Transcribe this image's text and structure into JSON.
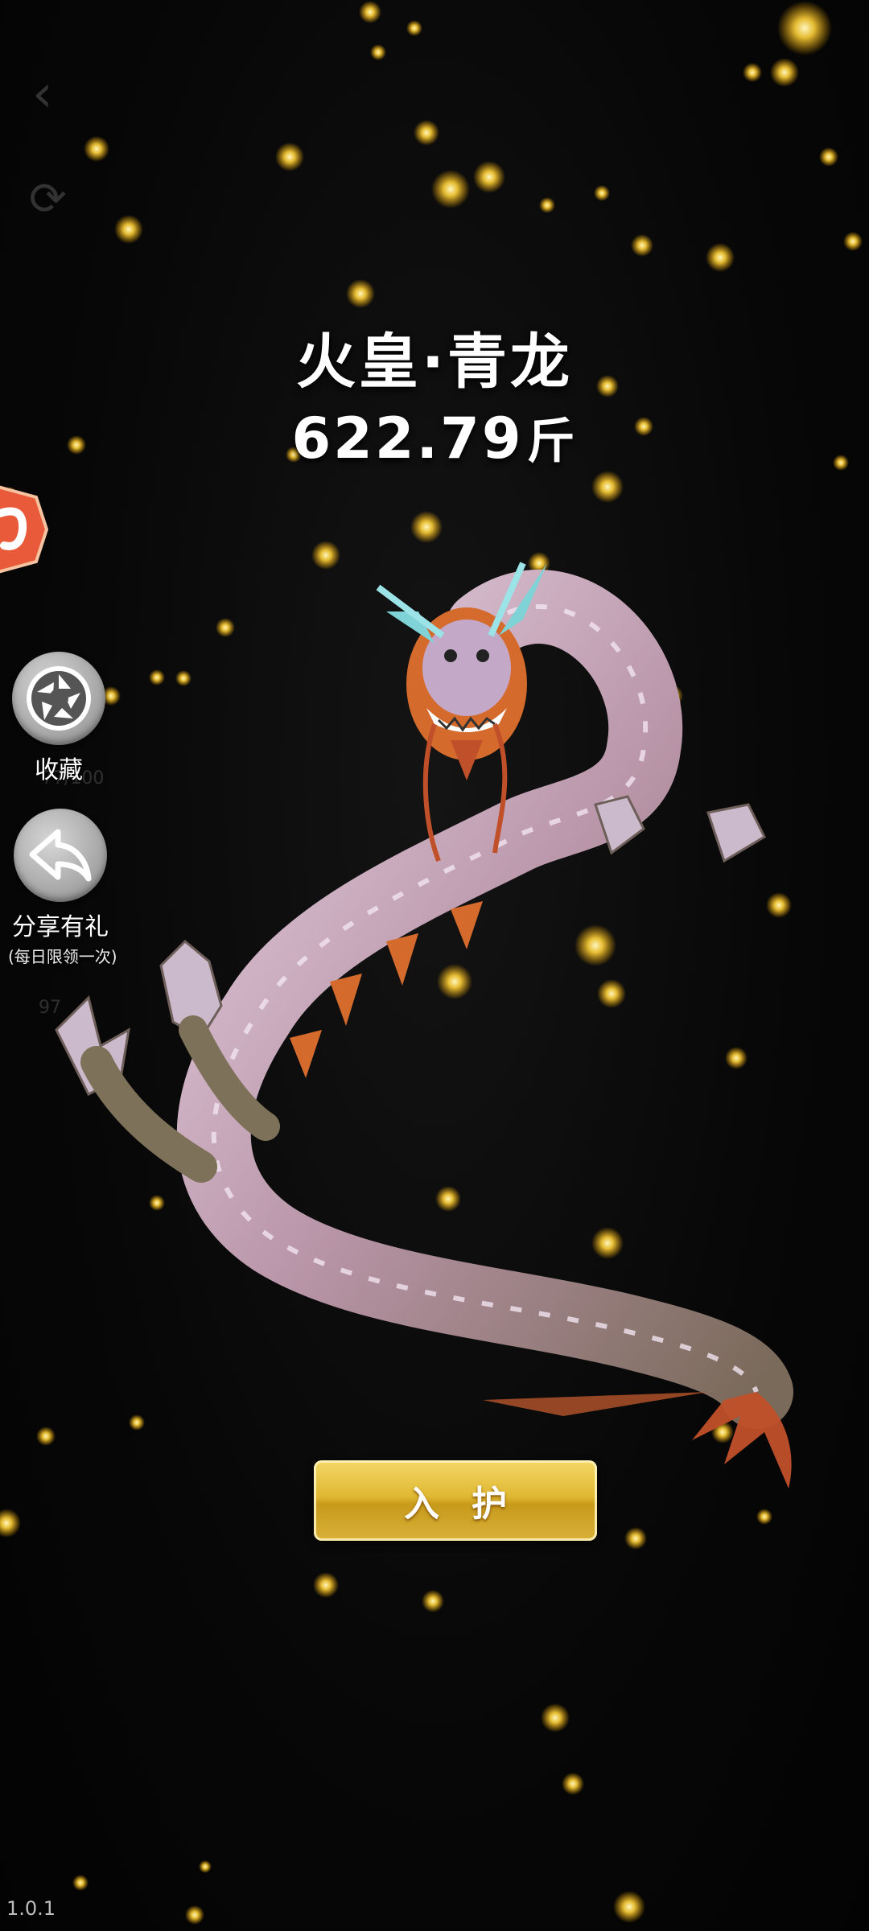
{
  "game": {
    "fish_name": "火皇·青龙",
    "weight_value": "622.79",
    "weight_unit": "斤"
  },
  "side_buttons": {
    "collect_label": "收藏",
    "share_label": "分享有礼",
    "share_sublabel": "(每日限领一次)"
  },
  "ghost": {
    "progress_text": "77/100",
    "count_text": "97"
  },
  "action": {
    "enter_label": "入护"
  },
  "footer": {
    "version": "1.0.1"
  },
  "colors": {
    "button_gold": "#e0b832",
    "glow_yellow": "#ffd23a",
    "dragon_body": "#c9a9c0",
    "dragon_mane": "#d8642a"
  }
}
